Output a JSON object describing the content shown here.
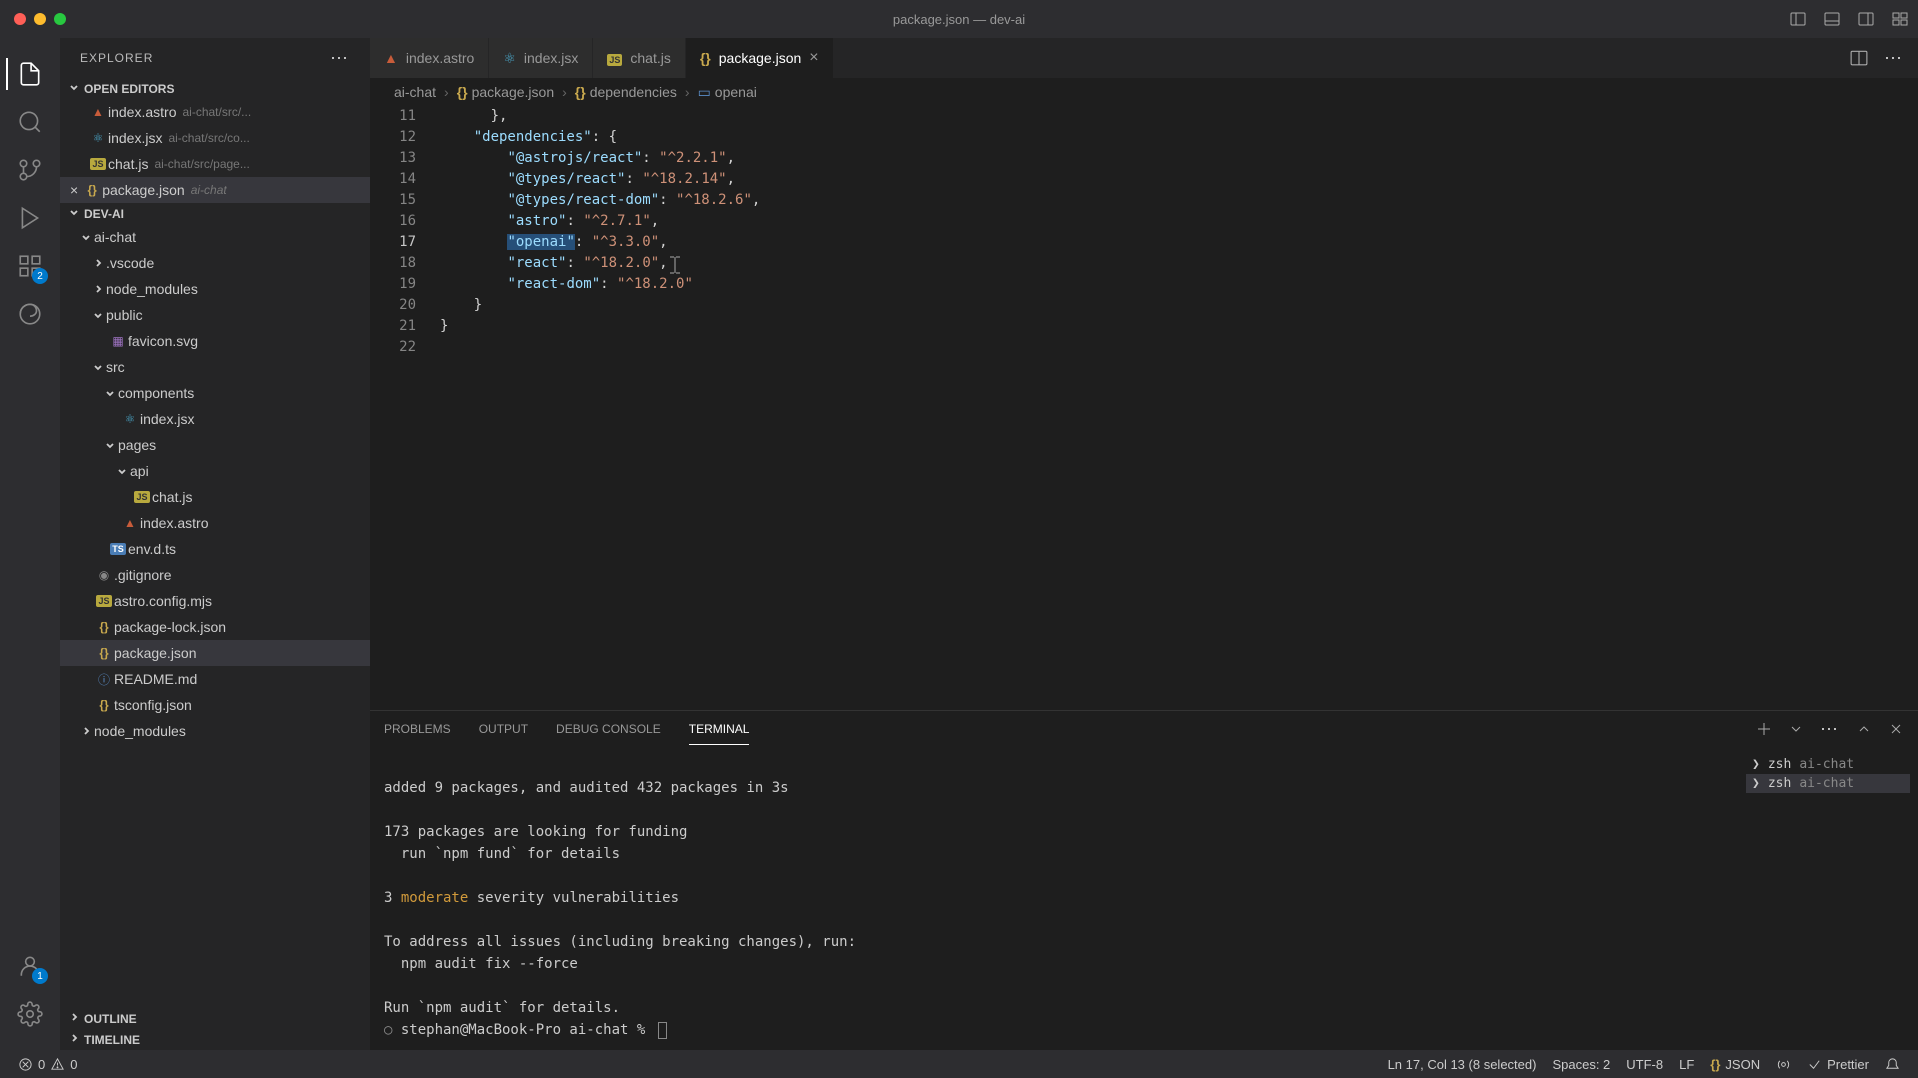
{
  "window": {
    "title": "package.json — dev-ai"
  },
  "sidebar": {
    "title": "EXPLORER",
    "sections": {
      "open_editors": "OPEN EDITORS",
      "project": "DEV-AI",
      "outline": "OUTLINE",
      "timeline": "TIMELINE"
    },
    "open_editors": [
      {
        "name": "index.astro",
        "hint": "ai-chat/src/..."
      },
      {
        "name": "index.jsx",
        "hint": "ai-chat/src/co..."
      },
      {
        "name": "chat.js",
        "hint": "ai-chat/src/page..."
      },
      {
        "name": "package.json",
        "hint": "ai-chat",
        "active": true
      }
    ],
    "tree": {
      "ai_chat": "ai-chat",
      "vscode": ".vscode",
      "node_modules": "node_modules",
      "public": "public",
      "favicon": "favicon.svg",
      "src": "src",
      "components": "components",
      "index_jsx": "index.jsx",
      "pages": "pages",
      "api": "api",
      "chat_js": "chat.js",
      "index_astro": "index.astro",
      "env_d_ts": "env.d.ts",
      "gitignore": ".gitignore",
      "astro_config": "astro.config.mjs",
      "pkg_lock": "package-lock.json",
      "pkg": "package.json",
      "readme": "README.md",
      "tsconfig": "tsconfig.json",
      "node_modules2": "node_modules"
    }
  },
  "tabs": [
    {
      "name": "index.astro",
      "icon": "astro"
    },
    {
      "name": "index.jsx",
      "icon": "react"
    },
    {
      "name": "chat.js",
      "icon": "js"
    },
    {
      "name": "package.json",
      "icon": "brace",
      "active": true,
      "close": true
    }
  ],
  "breadcrumb": {
    "root": "ai-chat",
    "file": "package.json",
    "path1": "dependencies",
    "path2": "openai"
  },
  "code": {
    "lines": [
      {
        "n": 11,
        "indent": "      ",
        "tokens": [
          [
            "p",
            "},"
          ]
        ]
      },
      {
        "n": 12,
        "indent": "    ",
        "tokens": [
          [
            "k",
            "\"dependencies\""
          ],
          [
            "p",
            ": {"
          ]
        ]
      },
      {
        "n": 13,
        "indent": "        ",
        "tokens": [
          [
            "k",
            "\"@astrojs/react\""
          ],
          [
            "p",
            ": "
          ],
          [
            "s",
            "\"^2.2.1\""
          ],
          [
            "p",
            ","
          ]
        ]
      },
      {
        "n": 14,
        "indent": "        ",
        "tokens": [
          [
            "k",
            "\"@types/react\""
          ],
          [
            "p",
            ": "
          ],
          [
            "s",
            "\"^18.2.14\""
          ],
          [
            "p",
            ","
          ]
        ]
      },
      {
        "n": 15,
        "indent": "        ",
        "tokens": [
          [
            "k",
            "\"@types/react-dom\""
          ],
          [
            "p",
            ": "
          ],
          [
            "s",
            "\"^18.2.6\""
          ],
          [
            "p",
            ","
          ]
        ]
      },
      {
        "n": 16,
        "indent": "        ",
        "tokens": [
          [
            "k",
            "\"astro\""
          ],
          [
            "p",
            ": "
          ],
          [
            "s",
            "\"^2.7.1\""
          ],
          [
            "p",
            ","
          ]
        ]
      },
      {
        "n": 17,
        "indent": "        ",
        "tokens": [
          [
            "k sel",
            "\"openai\""
          ],
          [
            "p",
            ": "
          ],
          [
            "s",
            "\"^3.3.0\""
          ],
          [
            "p",
            ","
          ]
        ],
        "current": true
      },
      {
        "n": 18,
        "indent": "        ",
        "tokens": [
          [
            "k",
            "\"react\""
          ],
          [
            "p",
            ": "
          ],
          [
            "s",
            "\"^18.2.0\""
          ],
          [
            "p",
            ","
          ]
        ]
      },
      {
        "n": 19,
        "indent": "        ",
        "tokens": [
          [
            "k",
            "\"react-dom\""
          ],
          [
            "p",
            ": "
          ],
          [
            "s",
            "\"^18.2.0\""
          ]
        ]
      },
      {
        "n": 20,
        "indent": "    ",
        "tokens": [
          [
            "p",
            "}"
          ]
        ]
      },
      {
        "n": 21,
        "indent": "",
        "tokens": [
          [
            "p",
            "}"
          ]
        ]
      },
      {
        "n": 22,
        "indent": "",
        "tokens": []
      }
    ]
  },
  "panel": {
    "tabs": {
      "problems": "PROBLEMS",
      "output": "OUTPUT",
      "debug": "DEBUG CONSOLE",
      "terminal": "TERMINAL"
    },
    "terminal": {
      "lines": [
        "",
        "added 9 packages, and audited 432 packages in 3s",
        "",
        "173 packages are looking for funding",
        "  run `npm fund` for details",
        "",
        "3 |moderate| severity vulnerabilities",
        "",
        "To address all issues (including breaking changes), run:",
        "  npm audit fix --force",
        "",
        "Run `npm audit` for details.",
        "stephan@MacBook-Pro ai-chat % "
      ],
      "sessions": [
        {
          "shell": "zsh",
          "path": "ai-chat"
        },
        {
          "shell": "zsh",
          "path": "ai-chat"
        }
      ]
    }
  },
  "status": {
    "errors": "0",
    "warnings": "0",
    "pos": "Ln 17, Col 13 (8 selected)",
    "spaces": "Spaces: 2",
    "encoding": "UTF-8",
    "eol": "LF",
    "lang": "JSON",
    "prettier": "Prettier"
  },
  "activity_badges": {
    "ext": "2",
    "acc": "1"
  }
}
